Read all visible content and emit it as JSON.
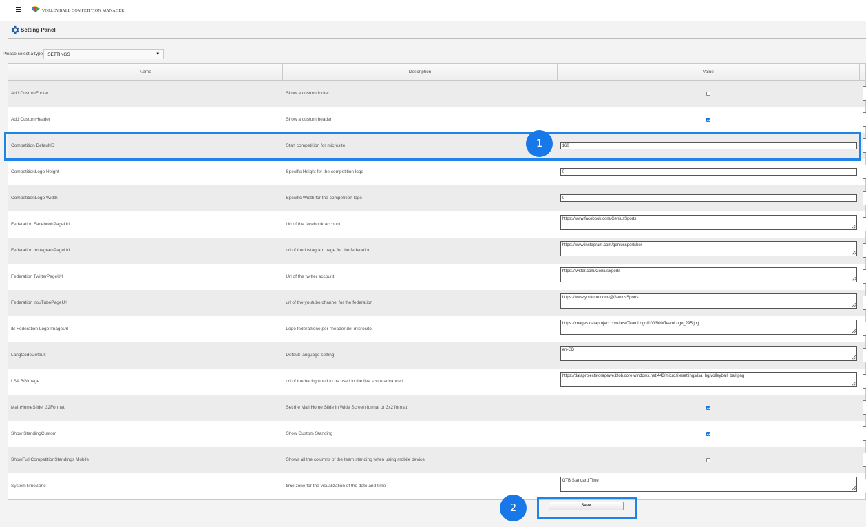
{
  "app": {
    "title": "VOLLEYBALL COMPETITION MANAGER",
    "menu_icon": "hamburger-icon"
  },
  "panel": {
    "title": "Setting Panel",
    "icon": "gear-icon"
  },
  "type_selector": {
    "label": "Please select a type",
    "selected": "SETTINGS"
  },
  "table": {
    "headers": [
      "Name",
      "Description",
      "Value"
    ],
    "rows": [
      {
        "name": "Add CustomFooter",
        "description": "Show a custom footer",
        "kind": "checkbox",
        "checked": false
      },
      {
        "name": "Add CustomHeader",
        "description": "Show a custom header",
        "kind": "checkbox",
        "checked": true
      },
      {
        "name": "Competition DefaultID",
        "description": "Start competition for microsite",
        "kind": "input",
        "value": "160"
      },
      {
        "name": "CompetitionLogo Height",
        "description": "Specific Height for the competition logo",
        "kind": "input",
        "value": "0"
      },
      {
        "name": "CompetitionLogo Width",
        "description": "Specific Width for the competition logo",
        "kind": "input",
        "value": "0"
      },
      {
        "name": "Federation FacebookPageUrl",
        "description": "Url of the facebook account,",
        "kind": "textarea",
        "value": "https://www.facebook.com/GeniusSports"
      },
      {
        "name": "Federation InstagramPageUrl",
        "description": "url of the instagram page for the federation",
        "kind": "textarea",
        "value": "https://www.instagram.com/geniussportsho/"
      },
      {
        "name": "Federation TwitterPageUrl",
        "description": "Url of the twitter account",
        "kind": "textarea",
        "value": "https://twitter.com/GeniusSports"
      },
      {
        "name": "Federation YouTubePageUrl",
        "description": "url of the youtube channel for the federation",
        "kind": "textarea",
        "value": "https://www.youtube.com/@GeniusSports"
      },
      {
        "name": "IB Federation Logo ImageUrl",
        "description": "Logo federazione per l'header del microsito",
        "kind": "textarea",
        "value": "https://images.dataproject.com/test/TeamLogo/100/500/TeamLogo_295.jpg"
      },
      {
        "name": "LangCodeDefault",
        "description": "Default language setting",
        "kind": "textarea",
        "value": "en-GB"
      },
      {
        "name": "LSA BGImage",
        "description": "url of the background to be used in the live score advanced",
        "kind": "textarea",
        "value": "https://dataprojectstoragewe.blob.core.windows.net:443/micrositesettings/lsa_bg/volleyball_ball.png"
      },
      {
        "name": "MainHomeSlider 32Format",
        "description": "Set the Mail Home Slide in Wide Screen format or 3x2 format",
        "kind": "checkbox",
        "checked": true
      },
      {
        "name": "Show StandingCustom",
        "description": "Show Custom Standing",
        "kind": "checkbox",
        "checked": true
      },
      {
        "name": "ShowFull CompetitionStandings Mobile",
        "description": "Shows all the columns of the team standing when using mobile device",
        "kind": "checkbox",
        "checked": false
      },
      {
        "name": "SystemTimeZone",
        "description": "time zone for the visualization of the date and time",
        "kind": "textarea",
        "value": "GTB Standard Time"
      }
    ]
  },
  "save_label": "Save",
  "annotations": {
    "badge_1": "1",
    "badge_2": "2",
    "color": "#1e84e8"
  }
}
